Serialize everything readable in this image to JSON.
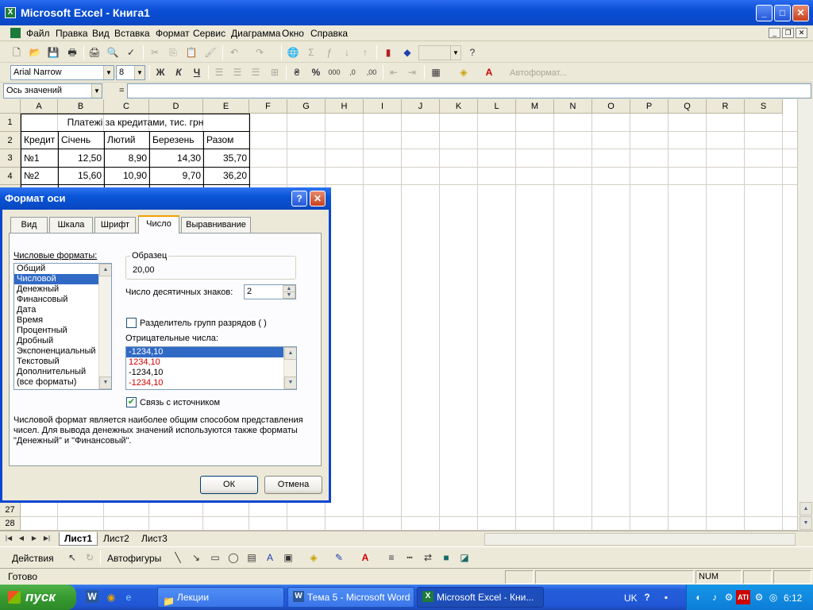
{
  "window": {
    "title": "Microsoft Excel - Книга1",
    "app_icon": "X"
  },
  "menu": [
    "Файл",
    "Правка",
    "Вид",
    "Вставка",
    "Формат",
    "Сервис",
    "Диаграмма",
    "Окно",
    "Справка"
  ],
  "format_toolbar": {
    "font": "Arial Narrow",
    "size": "8",
    "autoformat": "Автоформат..."
  },
  "formula_bar": {
    "name_box": "Ось значений",
    "fx": "="
  },
  "columns": [
    "A",
    "B",
    "C",
    "D",
    "E",
    "F",
    "G",
    "H",
    "I",
    "J",
    "K",
    "L",
    "M",
    "N",
    "O",
    "P",
    "Q",
    "R",
    "S"
  ],
  "rows": [
    "1",
    "2",
    "3",
    "4"
  ],
  "rows_bottom": [
    "27",
    "28"
  ],
  "sheet": {
    "title": "Платежі за кредитами, тис. грн",
    "headers": [
      "Кредит",
      "Січень",
      "Лютий",
      "Березень",
      "Разом"
    ],
    "data": [
      [
        "№1",
        "12,50",
        "8,90",
        "14,30",
        "35,70"
      ],
      [
        "№2",
        "15,60",
        "10,90",
        "9,70",
        "36,20"
      ]
    ]
  },
  "sheet_tabs": [
    "Лист1",
    "Лист2",
    "Лист3"
  ],
  "draw_toolbar": {
    "actions": "Действия",
    "autoshapes": "Автофигуры"
  },
  "status": {
    "ready": "Готово",
    "num": "NUM"
  },
  "dialog": {
    "title": "Формат оси",
    "tabs": [
      "Вид",
      "Шкала",
      "Шрифт",
      "Число",
      "Выравнивание"
    ],
    "formats_label": "Числовые форматы:",
    "formats": [
      "Общий",
      "Числовой",
      "Денежный",
      "Финансовый",
      "Дата",
      "Время",
      "Процентный",
      "Дробный",
      "Экспоненциальный",
      "Текстовый",
      "Дополнительный",
      "(все форматы)"
    ],
    "sample_label": "Образец",
    "sample_value": "20,00",
    "decimals_label": "Число десятичных знаков:",
    "decimals_value": "2",
    "separator_label": "Разделитель групп разрядов ( )",
    "negative_label": "Отрицательные числа:",
    "negatives": [
      "-1234,10",
      "1234,10",
      "-1234,10",
      "-1234,10"
    ],
    "link_label": "Связь с источником",
    "description": "Числовой формат является наиболее общим способом представления чисел. Для вывода денежных значений используются также форматы \"Денежный\" и \"Финансовый\".",
    "ok": "ОК",
    "cancel": "Отмена"
  },
  "taskbar": {
    "start": "пуск",
    "tasks": [
      "Лекции",
      "Тема 5 - Microsoft Word",
      "Microsoft Excel - Кни..."
    ],
    "lang": "UK",
    "time": "6:12"
  }
}
